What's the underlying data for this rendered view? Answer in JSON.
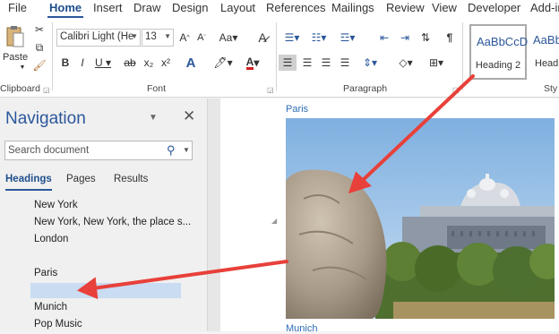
{
  "ribbon_tabs": [
    "File",
    "Home",
    "Insert",
    "Draw",
    "Design",
    "Layout",
    "References",
    "Mailings",
    "Review",
    "View",
    "Developer",
    "Add-in"
  ],
  "active_tab": "Home",
  "clipboard": {
    "paste_label": "Paste",
    "group_label": "Clipboard"
  },
  "font": {
    "name": "Calibri Light (He",
    "size": "13",
    "group_label": "Font"
  },
  "paragraph": {
    "group_label": "Paragraph"
  },
  "styles": {
    "items": [
      {
        "sample": "AaBbCcD",
        "name": "Heading 2"
      },
      {
        "sample": "AaBb",
        "name": "Head"
      }
    ],
    "group_label": "Sty"
  },
  "navigation": {
    "title": "Navigation",
    "search_placeholder": "Search document",
    "tabs": [
      "Headings",
      "Pages",
      "Results"
    ],
    "headings": [
      "New York",
      "New York, New York, the place s...",
      "London",
      "Paris",
      "",
      "Munich",
      "Pop Music"
    ]
  },
  "document": {
    "caption_paris": "Paris",
    "caption_munich": "Munich"
  },
  "colors": {
    "accent": "#2b579a",
    "selection": "#c9dcf2",
    "arrow": "#e8403a",
    "caption": "#2e6db4"
  }
}
